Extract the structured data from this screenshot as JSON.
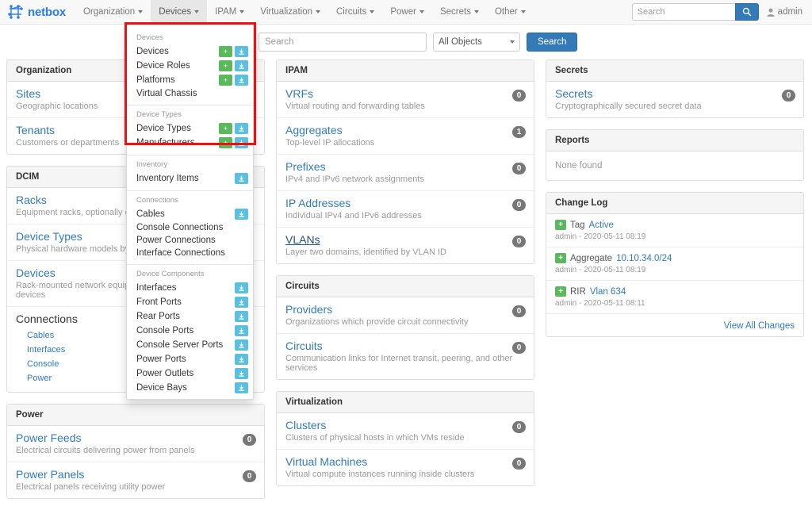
{
  "navbar": {
    "brand": "netbox",
    "brand_icon": "netbox-mesh-logo-icon",
    "items": [
      {
        "label": "Organization",
        "active": false
      },
      {
        "label": "Devices",
        "active": true
      },
      {
        "label": "IPAM",
        "active": false
      },
      {
        "label": "Virtualization",
        "active": false
      },
      {
        "label": "Circuits",
        "active": false
      },
      {
        "label": "Power",
        "active": false
      },
      {
        "label": "Secrets",
        "active": false
      },
      {
        "label": "Other",
        "active": false
      }
    ],
    "search_placeholder": "Search",
    "search_value": "",
    "search_icon": "search-icon",
    "user_label": "admin",
    "user_icon": "user-icon"
  },
  "search_row": {
    "placeholder": "Search",
    "value": "",
    "select_value": "All Objects",
    "button_label": "Search"
  },
  "devices_menu": {
    "groups": [
      {
        "header": "Devices",
        "items": [
          {
            "label": "Devices",
            "add": true,
            "import": true
          },
          {
            "label": "Device Roles",
            "add": true,
            "import": true
          },
          {
            "label": "Platforms",
            "add": true,
            "import": true
          },
          {
            "label": "Virtual Chassis",
            "add": false,
            "import": false
          }
        ]
      },
      {
        "header": "Device Types",
        "items": [
          {
            "label": "Device Types",
            "add": true,
            "import": true
          },
          {
            "label": "Manufacturers",
            "add": true,
            "import": true
          }
        ]
      },
      {
        "header": "Inventory",
        "items": [
          {
            "label": "Inventory Items",
            "add": false,
            "import": true
          }
        ]
      },
      {
        "header": "Connections",
        "items": [
          {
            "label": "Cables",
            "add": false,
            "import": true
          },
          {
            "label": "Console Connections",
            "add": false,
            "import": false
          },
          {
            "label": "Power Connections",
            "add": false,
            "import": false
          },
          {
            "label": "Interface Connections",
            "add": false,
            "import": false
          }
        ]
      },
      {
        "header": "Device Components",
        "items": [
          {
            "label": "Interfaces",
            "add": false,
            "import": true
          },
          {
            "label": "Front Ports",
            "add": false,
            "import": true
          },
          {
            "label": "Rear Ports",
            "add": false,
            "import": true
          },
          {
            "label": "Console Ports",
            "add": false,
            "import": true
          },
          {
            "label": "Console Server Ports",
            "add": false,
            "import": true
          },
          {
            "label": "Power Ports",
            "add": false,
            "import": true
          },
          {
            "label": "Power Outlets",
            "add": false,
            "import": true
          },
          {
            "label": "Device Bays",
            "add": false,
            "import": true
          }
        ]
      }
    ],
    "add_glyph": "+",
    "import_glyph": "import-icon"
  },
  "panels": {
    "organization": {
      "title": "Organization",
      "rows": [
        {
          "title": "Sites",
          "desc": "Geographic locations",
          "badge": null
        },
        {
          "title": "Tenants",
          "desc": "Customers or departments",
          "badge": null
        }
      ]
    },
    "dcim": {
      "title": "DCIM",
      "rows": [
        {
          "title": "Racks",
          "desc": "Equipment racks, optionally organized by group",
          "badge": null
        },
        {
          "title": "Device Types",
          "desc": "Physical hardware models by manufacturer",
          "badge": null
        },
        {
          "title": "Devices",
          "desc": "Rack-mounted network equipment, servers, and other devices",
          "badge": null
        }
      ],
      "connections": {
        "title": "Connections",
        "links": [
          "Cables",
          "Interfaces",
          "Console",
          "Power"
        ]
      }
    },
    "power": {
      "title": "Power",
      "rows": [
        {
          "title": "Power Feeds",
          "desc": "Electrical circuits delivering power from panels",
          "badge": "0"
        },
        {
          "title": "Power Panels",
          "desc": "Electrical panels receiving utility power",
          "badge": "0"
        }
      ]
    },
    "ipam": {
      "title": "IPAM",
      "rows": [
        {
          "title": "VRFs",
          "desc": "Virtual routing and forwarding tables",
          "badge": "0"
        },
        {
          "title": "Aggregates",
          "desc": "Top-level IP allocations",
          "badge": "1"
        },
        {
          "title": "Prefixes",
          "desc": "IPv4 and IPv6 network assignments",
          "badge": "0"
        },
        {
          "title": "IP Addresses",
          "desc": "Individual IPv4 and IPv6 addresses",
          "badge": "0"
        },
        {
          "title": "VLANs",
          "desc": "Layer two domains, identified by VLAN ID",
          "badge": "0",
          "hovered": true
        }
      ]
    },
    "circuits": {
      "title": "Circuits",
      "rows": [
        {
          "title": "Providers",
          "desc": "Organizations which provide circuit connectivity",
          "badge": "0"
        },
        {
          "title": "Circuits",
          "desc": "Communication links for Internet transit, peering, and other services",
          "badge": "0"
        }
      ]
    },
    "virtualization": {
      "title": "Virtualization",
      "rows": [
        {
          "title": "Clusters",
          "desc": "Clusters of physical hosts in which VMs reside",
          "badge": "0"
        },
        {
          "title": "Virtual Machines",
          "desc": "Virtual compute instances running inside clusters",
          "badge": "0"
        }
      ]
    },
    "secrets": {
      "title": "Secrets",
      "rows": [
        {
          "title": "Secrets",
          "desc": "Cryptographically secured secret data",
          "badge": "0"
        }
      ]
    },
    "reports": {
      "title": "Reports",
      "empty_text": "None found"
    },
    "changelog": {
      "title": "Change Log",
      "entries": [
        {
          "glyph": "+",
          "type": "Tag",
          "name": "Active",
          "meta": "admin - 2020-05-11 08:19"
        },
        {
          "glyph": "+",
          "type": "Aggregate",
          "name": "10.10.34.0/24",
          "meta": "admin - 2020-05-11 08:19"
        },
        {
          "glyph": "+",
          "type": "RIR",
          "name": "Vlan 634",
          "meta": "admin - 2020-05-11 08:11"
        }
      ],
      "footer_link": "View All Changes"
    }
  },
  "colors": {
    "brand_blue": "#2b7ce9",
    "link_blue": "#337ab7",
    "primary_button": "#337ab7",
    "add_green": "#5cb85c",
    "import_blue": "#5bc0de",
    "badge_gray": "#777777",
    "highlight_red": "#f01010"
  }
}
